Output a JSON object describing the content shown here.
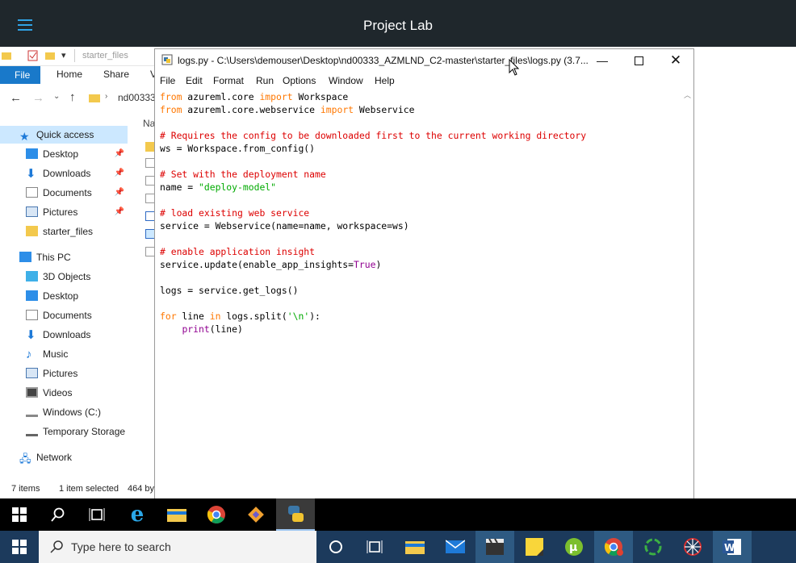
{
  "lab": {
    "title": "Project Lab"
  },
  "explorer": {
    "qat_path": "starter_files",
    "ribbon_tabs": [
      "File",
      "Home",
      "Share",
      "V"
    ],
    "address": "nd00333",
    "column_header": "Na",
    "nav": {
      "quick_access": "Quick access",
      "qa_items": [
        "Desktop",
        "Downloads",
        "Documents",
        "Pictures",
        "starter_files"
      ],
      "this_pc": "This PC",
      "pc_items": [
        "3D Objects",
        "Desktop",
        "Documents",
        "Downloads",
        "Music",
        "Pictures",
        "Videos",
        "Windows (C:)",
        "Temporary Storage"
      ],
      "network": "Network"
    },
    "status": {
      "count": "7 items",
      "selected": "1 item selected",
      "size": "464 by"
    }
  },
  "idle": {
    "title": "logs.py - C:\\Users\\demouser\\Desktop\\nd00333_AZMLND_C2-master\\starter_files\\logs.py (3.7...",
    "menu": [
      "File",
      "Edit",
      "Format",
      "Run",
      "Options",
      "Window",
      "Help"
    ],
    "code_lines": [
      [
        {
          "t": "from",
          "c": "kw"
        },
        {
          "t": " azureml.core ",
          "c": ""
        },
        {
          "t": "import",
          "c": "kw"
        },
        {
          "t": " Workspace",
          "c": ""
        }
      ],
      [
        {
          "t": "from",
          "c": "kw"
        },
        {
          "t": " azureml.core.webservice ",
          "c": ""
        },
        {
          "t": "import",
          "c": "kw"
        },
        {
          "t": " Webservice",
          "c": ""
        }
      ],
      [],
      [
        {
          "t": "# Requires the config to be downloaded first to the current working directory",
          "c": "cm"
        }
      ],
      [
        {
          "t": "ws = Workspace.from_config()",
          "c": ""
        }
      ],
      [],
      [
        {
          "t": "# Set with the deployment name",
          "c": "cm"
        }
      ],
      [
        {
          "t": "name = ",
          "c": ""
        },
        {
          "t": "\"deploy-model\"",
          "c": "st"
        }
      ],
      [],
      [
        {
          "t": "# load existing web service",
          "c": "cm"
        }
      ],
      [
        {
          "t": "service = Webservice(name=name, workspace=ws)",
          "c": ""
        }
      ],
      [],
      [
        {
          "t": "# enable application insight",
          "c": "cm"
        }
      ],
      [
        {
          "t": "service.update(enable_app_insights=",
          "c": ""
        },
        {
          "t": "True",
          "c": "bi"
        },
        {
          "t": ")",
          "c": ""
        }
      ],
      [],
      [
        {
          "t": "logs = service.get_logs()",
          "c": ""
        }
      ],
      [],
      [
        {
          "t": "for",
          "c": "kw"
        },
        {
          "t": " line ",
          "c": ""
        },
        {
          "t": "in",
          "c": "kw"
        },
        {
          "t": " logs.split(",
          "c": ""
        },
        {
          "t": "'\\n'",
          "c": "st"
        },
        {
          "t": "):",
          "c": ""
        }
      ],
      [
        {
          "t": "    ",
          "c": ""
        },
        {
          "t": "print",
          "c": "bi"
        },
        {
          "t": "(line)",
          "c": ""
        }
      ]
    ]
  },
  "taskbar": {
    "search_placeholder": "Type here to search"
  },
  "colors": {
    "accent": "#1979ca",
    "labbar": "#1f272c",
    "keyword": "#ff7700",
    "comment": "#dd0000",
    "string": "#00aa00",
    "builtin": "#900090"
  }
}
